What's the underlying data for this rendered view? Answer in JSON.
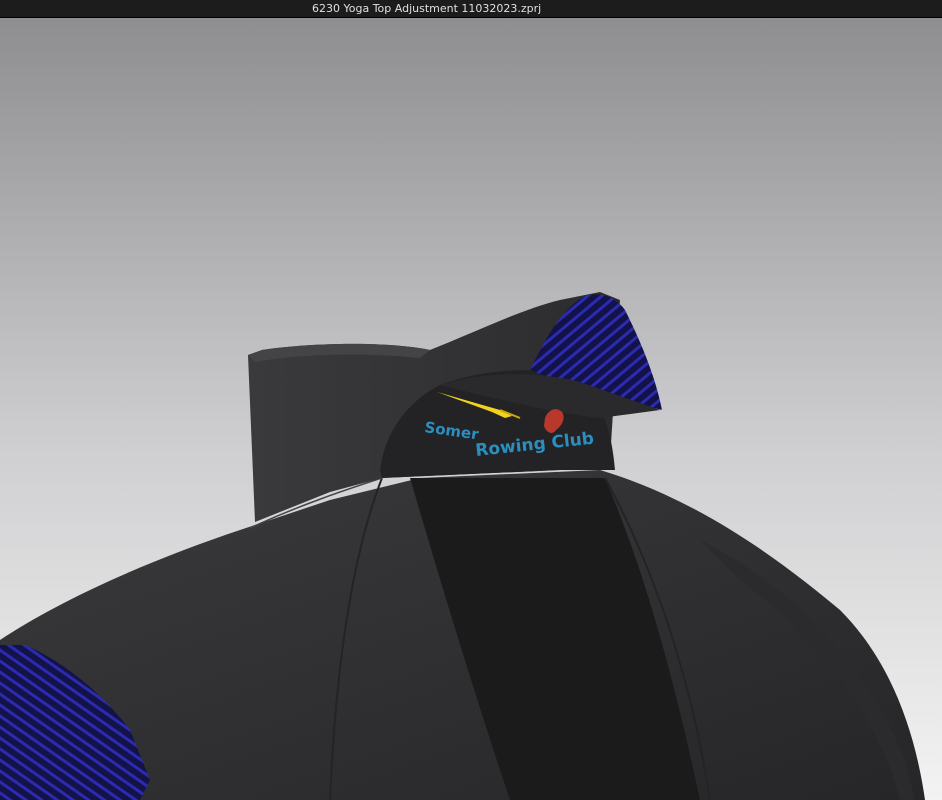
{
  "window": {
    "title": "6230 Yoga Top Adjustment 11032023.zprj"
  },
  "viewport": {
    "background_top": "#8e8e91",
    "background_bottom": "#f2f2f2",
    "garment": {
      "body_color": "#2e2e30",
      "panel_color": "#1a1a1a",
      "accent_color": "#1a1a5c",
      "stripe_color": "#2a2ab0"
    },
    "logo": {
      "word1": "Somer",
      "word2": "Rowing Club",
      "color": "#2a8fbf",
      "blade_color": "#f2d21e",
      "crest_color": "#b8392c"
    }
  }
}
